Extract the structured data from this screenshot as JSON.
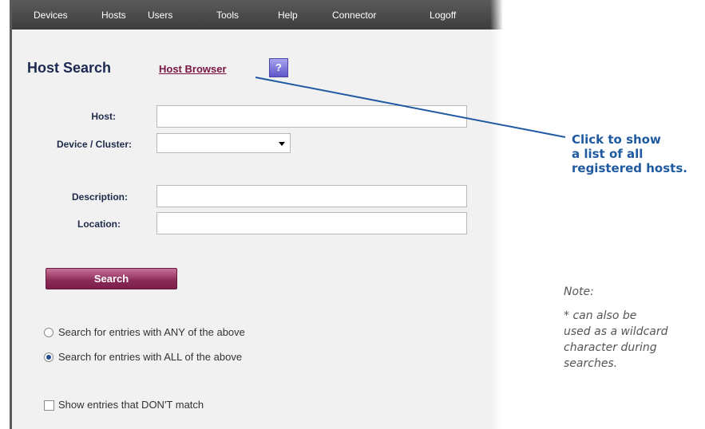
{
  "nav": {
    "items": [
      "Devices",
      "Hosts",
      "Users",
      "Tools",
      "Help",
      "Connector",
      "Logoff"
    ]
  },
  "page": {
    "title": "Host Search",
    "host_browser_link": "Host Browser",
    "help_label": "?"
  },
  "form": {
    "host_label": "Host:",
    "host_value": "",
    "device_cluster_label": "Device / Cluster:",
    "device_cluster_selected": "",
    "description_label": "Description:",
    "description_value": "",
    "location_label": "Location:",
    "location_value": "",
    "search_button": "Search",
    "match_options": [
      {
        "label": "Search for entries with ANY of the above",
        "checked": false
      },
      {
        "label": "Search for entries with ALL of the above",
        "checked": true
      }
    ],
    "invert_checkbox": {
      "label": "Show entries that DON'T match",
      "checked": false
    }
  },
  "callout": {
    "lines": [
      "Click to show",
      "a list of all",
      "registered hosts."
    ],
    "color": "#1f5aa0"
  },
  "note": {
    "title": "Note:",
    "lines": [
      "* can also be",
      "used as a wildcard",
      "character during",
      "searches."
    ]
  },
  "colors": {
    "nav_bar": "#4a4a4a",
    "search_button": "#8a2a56",
    "link": "#7a1440",
    "help_button": "#6f67d6"
  }
}
